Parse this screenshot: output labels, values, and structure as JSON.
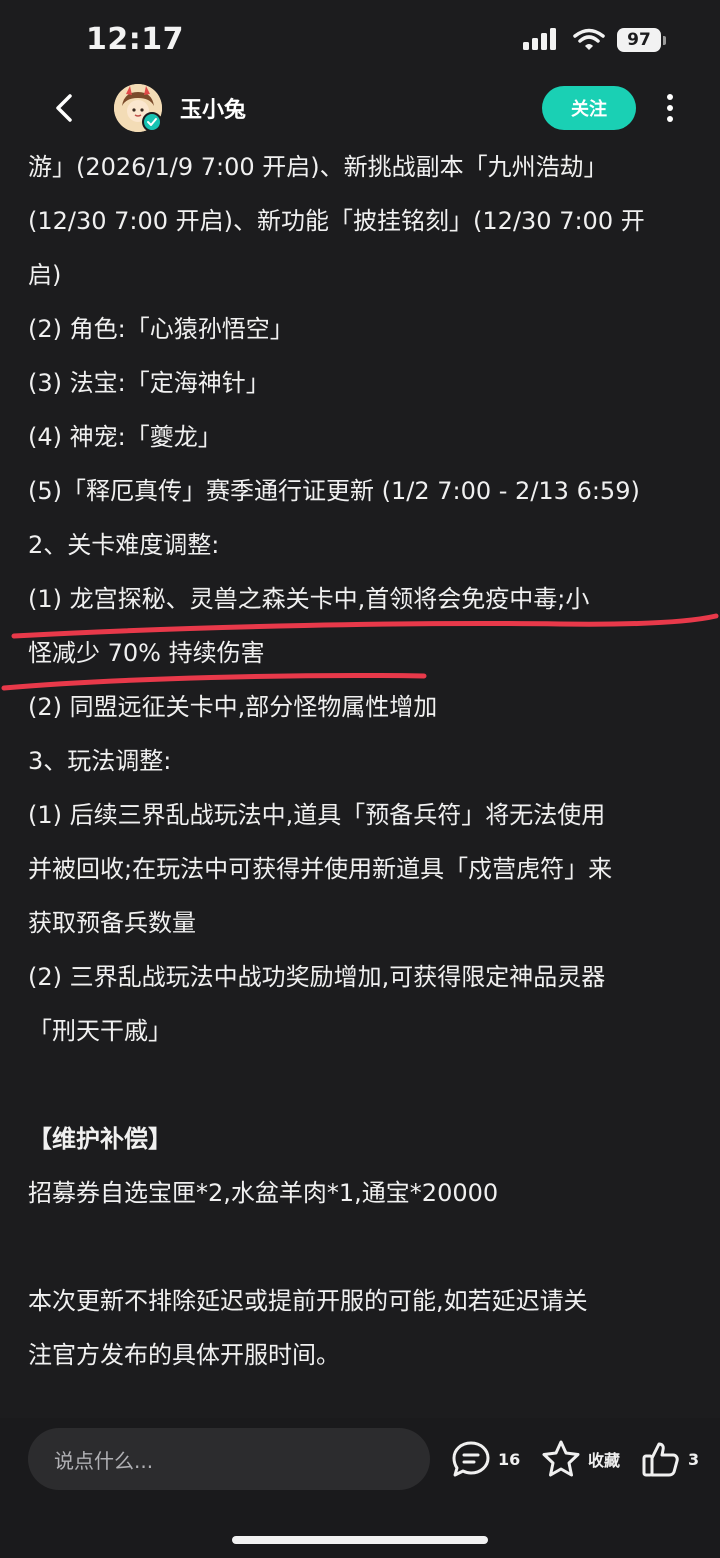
{
  "status_bar": {
    "time": "12:17",
    "battery": "97"
  },
  "header": {
    "username": "玉小兔",
    "follow_label": "关注"
  },
  "post": {
    "lines": [
      "游」(2026/1/9 7:00 开启)、新挑战副本「九州浩劫」",
      "(12/30 7:00 开启)、新功能「披挂铭刻」(12/30 7:00 开",
      "启)",
      "(2) 角色:「心猿孙悟空」",
      "(3) 法宝:「定海神针」",
      "(4) 神宠:「夔龙」",
      "(5)「释厄真传」赛季通行证更新 (1/2 7:00 - 2/13 6:59)",
      "2、关卡难度调整:",
      "(1) 龙宫探秘、灵兽之森关卡中,首领将会免疫中毒;小",
      "怪减少 70% 持续伤害",
      "(2) 同盟远征关卡中,部分怪物属性增加",
      "3、玩法调整:",
      "(1) 后续三界乱战玩法中,道具「预备兵符」将无法使用",
      "并被回收;在玩法中可获得并使用新道具「戍营虎符」来",
      "获取预备兵数量",
      "(2) 三界乱战玩法中战功奖励增加,可获得限定神品灵器",
      "「刑天干戚」"
    ],
    "compensation_title": "【维护补偿】",
    "compensation_text": "招募券自选宝匣*2,水盆羊肉*1,通宝*20000",
    "notice_lines": [
      "本次更新不排除延迟或提前开服的可能,如若延迟请关",
      "注官方发布的具体开服时间。"
    ]
  },
  "bottom_bar": {
    "comment_placeholder": "说点什么...",
    "comment_count": "16",
    "favorite_label": "收藏",
    "like_count": "3"
  },
  "colors": {
    "background": "#1c1c1e",
    "accent": "#1ad0b4",
    "annotation": "#e8394a"
  }
}
